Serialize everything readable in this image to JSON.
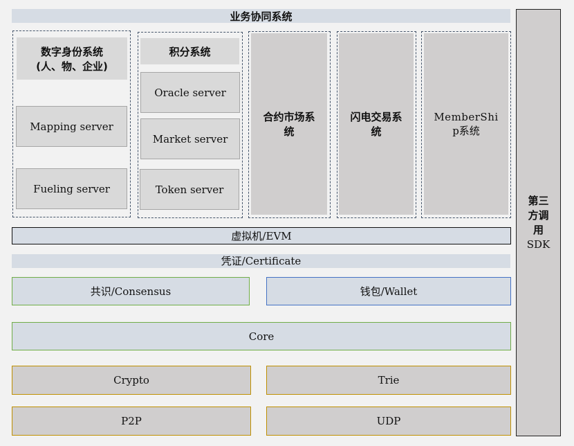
{
  "title": "业务协同系统",
  "business": {
    "identity": {
      "title_line1": "数字身份系统",
      "title_line2": "(人、物、企业)",
      "servers": [
        "Mapping server",
        "Fueling server"
      ]
    },
    "points": {
      "title": "积分系统",
      "servers": [
        "Oracle server",
        "Market server",
        "Token server"
      ]
    },
    "contract_market": {
      "line1": "合约市场系",
      "line2": "统"
    },
    "lightning_trade": {
      "line1": "闪电交易系",
      "line2": "统"
    },
    "membership": {
      "line1": "MemberShi",
      "line2": "p系统"
    }
  },
  "sdk": {
    "line1": "第三",
    "line2": "方调",
    "line3": "用",
    "line4": "SDK"
  },
  "layers": {
    "evm": "虚拟机/EVM",
    "certificate": "凭证/Certificate",
    "consensus": "共识/Consensus",
    "wallet": "钱包/Wallet",
    "core": "Core",
    "crypto": "Crypto",
    "trie": "Trie",
    "p2p": "P2P",
    "udp": "UDP"
  },
  "colors": {
    "light_blue": "#d6dce4",
    "grey": "#d9d9d9",
    "green_border": "#70ad47",
    "blue_border": "#4472c4",
    "gold_border": "#bf9000"
  }
}
